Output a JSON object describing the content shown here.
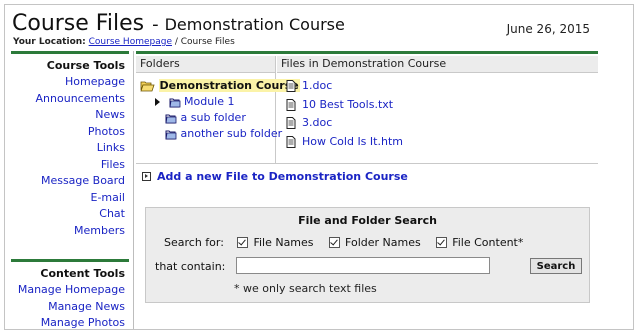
{
  "header": {
    "title": "Course Files",
    "separator": "-",
    "course_name": "Demonstration Course",
    "date": "June 26, 2015",
    "location_label": "Your Location:",
    "breadcrumb_link": "Course Homepage",
    "breadcrumb_sep": " / ",
    "breadcrumb_current": "Course Files"
  },
  "sidebar": {
    "course_tools_title": "Course Tools",
    "course_tools": [
      "Homepage",
      "Announcements",
      "News",
      "Photos",
      "Links",
      "Files",
      "Message Board",
      "E-mail",
      "Chat",
      "Members"
    ],
    "content_tools_title": "Content Tools",
    "content_tools": [
      "Manage Homepage",
      "Manage News",
      "Manage Photos"
    ]
  },
  "folders": {
    "header": "Folders",
    "items": [
      {
        "label": "Demonstration Course",
        "icon": "folder-open-icon",
        "selected": true
      },
      {
        "label": "Module 1",
        "icon": "folder-icon",
        "expandable": true
      },
      {
        "label": "a sub folder",
        "icon": "folder-icon"
      },
      {
        "label": "another sub folder",
        "icon": "folder-icon"
      }
    ]
  },
  "files": {
    "header": "Files in Demonstration Course",
    "items": [
      "1.doc",
      "10 Best Tools.txt",
      "3.doc",
      "How Cold Is It.htm"
    ]
  },
  "add_file_link": "Add a new File to Demonstration Course",
  "search": {
    "title": "File and Folder Search",
    "search_for_label": "Search for:",
    "options": [
      {
        "label": "File Names",
        "checked": true
      },
      {
        "label": "Folder Names",
        "checked": true
      },
      {
        "label": "File Content*",
        "checked": true
      }
    ],
    "contain_label": "that contain:",
    "input_value": "",
    "button_label": "Search",
    "note": "* we only search text files"
  },
  "colors": {
    "accent_bar": "#2c7a3a",
    "link": "#1a24c4",
    "selected_highlight": "#fbf3a8",
    "panel_bg": "#ececec"
  }
}
